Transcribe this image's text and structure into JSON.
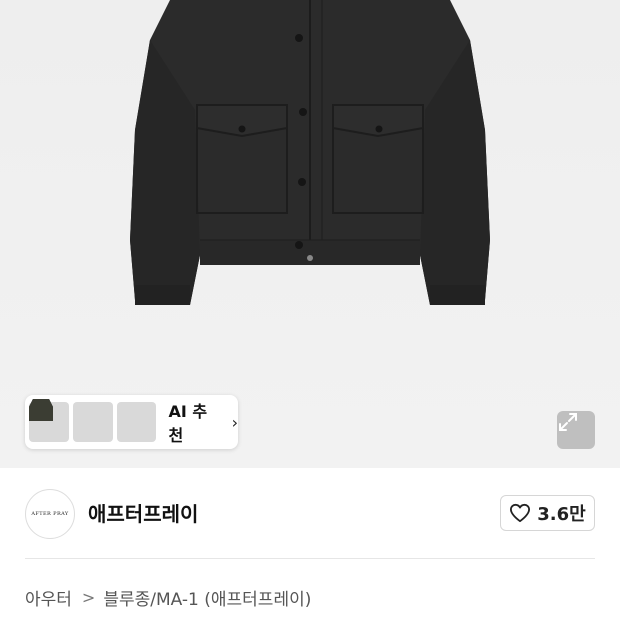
{
  "hero": {
    "image_alt": "black wool jacket"
  },
  "ai_recommend": {
    "label": "AI 추천",
    "chevron": "›"
  },
  "icons": {
    "expand": "expand-icon",
    "heart": "heart-outline-icon",
    "chevron": "chevron-right-icon"
  },
  "brand": {
    "logo_text": "AFTER PRAY",
    "name": "애프터프레이",
    "likes": "3.6만"
  },
  "breadcrumb": {
    "category": "아우터",
    "separator": ">",
    "subcategory": "블루종/MA-1 (애프터프레이)"
  },
  "colors": {
    "jacket": "#2a2a2a",
    "background": "#efefef",
    "text": "#111111"
  }
}
